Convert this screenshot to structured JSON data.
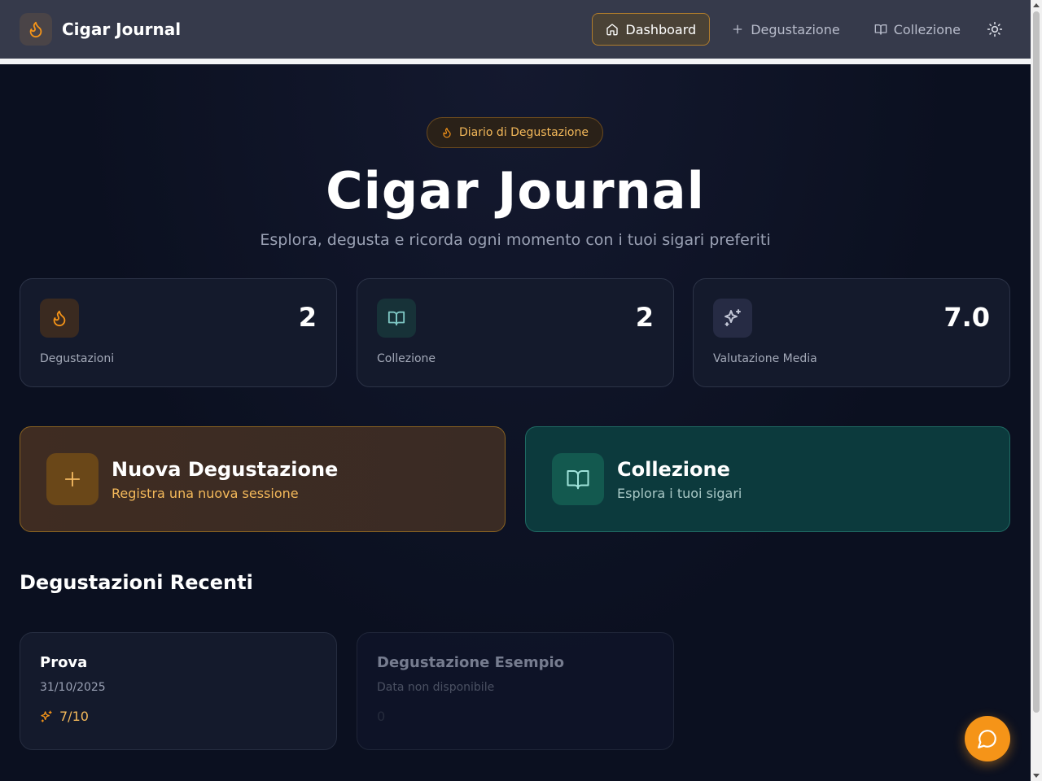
{
  "nav": {
    "brand": "Cigar Journal",
    "links": [
      {
        "label": "Dashboard",
        "icon": "home-icon",
        "active": true
      },
      {
        "label": "Degustazione",
        "icon": "plus-icon",
        "active": false
      },
      {
        "label": "Collezione",
        "icon": "book-icon",
        "active": false
      }
    ],
    "theme_icon": "sun-icon"
  },
  "hero": {
    "badge": "Diario di Degustazione",
    "title": "Cigar Journal",
    "subtitle": "Esplora, degusta e ricorda ogni momento con i tuoi sigari preferiti"
  },
  "stats": [
    {
      "label": "Degustazioni",
      "value": "2",
      "icon": "flame-icon"
    },
    {
      "label": "Collezione",
      "value": "2",
      "icon": "book-icon"
    },
    {
      "label": "Valutazione Media",
      "value": "7.0",
      "icon": "sparkles-icon"
    }
  ],
  "actions": [
    {
      "title": "Nuova Degustazione",
      "subtitle": "Registra una nuova sessione",
      "icon": "plus-icon"
    },
    {
      "title": "Collezione",
      "subtitle": "Esplora i tuoi sigari",
      "icon": "book-icon"
    }
  ],
  "recent": {
    "title": "Degustazioni Recenti",
    "items": [
      {
        "name": "Prova",
        "date": "31/10/2025",
        "rating": "7/10"
      },
      {
        "name": "Degustazione Esempio",
        "date": "Data non disponibile",
        "rating": "0"
      }
    ]
  },
  "colors": {
    "accent": "#f59418",
    "teal": "#0c3a3d",
    "amber_card": "#3e2c22"
  }
}
